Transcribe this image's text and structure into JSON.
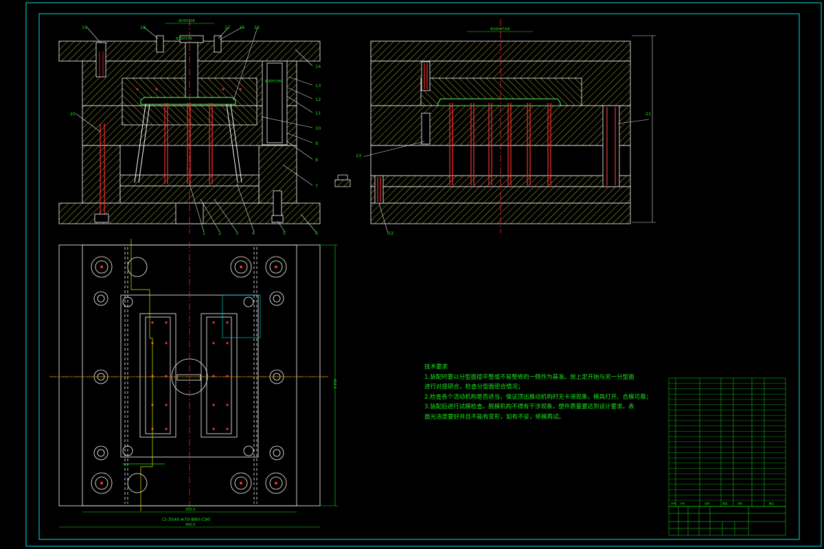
{
  "colors": {
    "background": "#000000",
    "border": "#00e5e5",
    "plate": "#ffffff",
    "hatch": "#c8c84a",
    "centerline": "#ff2a2a",
    "pin": "#ff3030",
    "cavity": "#60ff60",
    "dimension": "#19e619",
    "leader": "#e6e6e6"
  },
  "part_labels": [
    "1",
    "2",
    "3",
    "4",
    "5",
    "6",
    "7",
    "8",
    "9",
    "10",
    "11",
    "12",
    "13",
    "14",
    "15",
    "16",
    "17",
    "18",
    "19",
    "20",
    "21",
    "22",
    "23"
  ],
  "part_labels_display": {
    "p1": "1",
    "p2": "2",
    "p3": "3",
    "p4": "4",
    "p5": "5",
    "p6": "6",
    "p7": "7",
    "p8": "8",
    "p9": "9",
    "p10": "10",
    "p11": "11",
    "p12": "12",
    "p13": "13",
    "p14": "14",
    "p15": "15",
    "p16": "16",
    "p17": "17",
    "p18": "18",
    "p19": "19",
    "p20": "20",
    "p21": "21",
    "p22": "22",
    "p23": "23"
  },
  "dimensions": {
    "top_fit_left": "Φ25H7/f6",
    "top_fit_right": "Φ100H7/h6",
    "sprue_fit": "Φ25H7/f6",
    "bushing_fit": "Φ30H7/f6",
    "width_inner": "350.0",
    "width_outer": "400.0",
    "height": "450.0",
    "mold_base": "CI-3540-A70-B80-C90"
  },
  "technical_requirements": {
    "title": "技术要求",
    "lines": [
      "1.装配时要以分型面接平整或不易整修的一侧作为基准。放上定开始与另一分型面",
      "进行对接研合，检查分型面密合情况；",
      "2.检查各个活动机构是否适当，保证顶出推动机构时无卡滞现象，模具打开、合模可靠；",
      "3.装配后进行试模检查。脱模机构不得有干涉现象，塑件质量要达到设计要求。表",
      "面光洁度要好并且不能有变形，如有不妥，修模再试。"
    ]
  },
  "bom_header": [
    "序号",
    "代号",
    "名称",
    "数量",
    "材料",
    "备注"
  ]
}
